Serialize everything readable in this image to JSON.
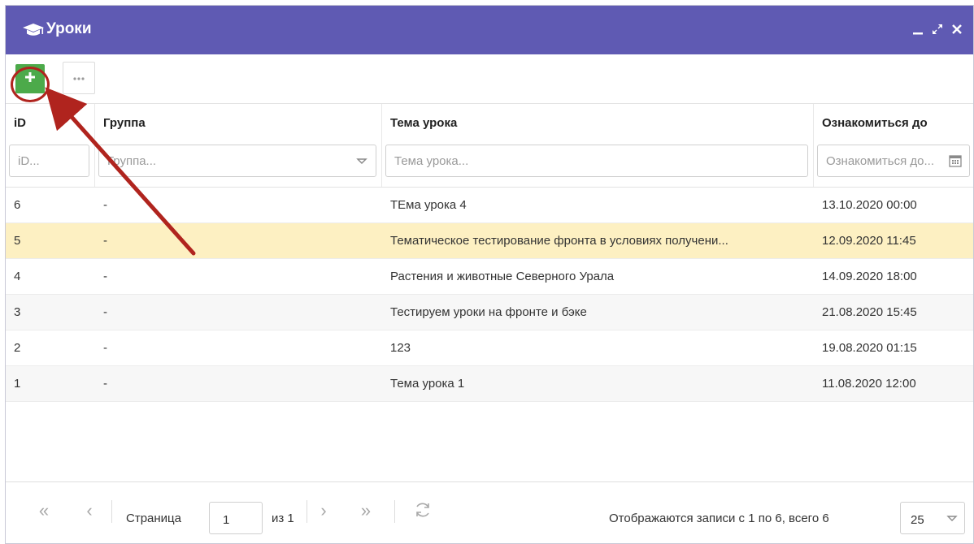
{
  "window": {
    "title": "Уроки",
    "icon": "graduation-cap-icon",
    "controls": [
      "minimize-icon",
      "maximize-icon",
      "close-icon"
    ],
    "title_bar_color": "#5f5ab3"
  },
  "toolbar": {
    "add_icon": "plus-icon",
    "add_button_color": "#4caa4a",
    "more_icon": "ellipsis-icon"
  },
  "columns": [
    {
      "label": "iD",
      "filter_placeholder": "iD...",
      "filter_icon": ""
    },
    {
      "label": "Группа",
      "filter_placeholder": "Группа...",
      "filter_icon": "dropdown-icon"
    },
    {
      "label": "Тема урока",
      "filter_placeholder": "Тема урока...",
      "filter_icon": ""
    },
    {
      "label": "Ознакомиться до",
      "filter_placeholder": "Ознакомиться до...",
      "filter_icon": "calendar-icon"
    }
  ],
  "rows": [
    {
      "id": "6",
      "group": "-",
      "topic": "ТЕма урока 4",
      "due": "13.10.2020 00:00"
    },
    {
      "id": "5",
      "group": "-",
      "topic": "Тематическое тестирование фронта в условиях получени...",
      "due": "12.09.2020 11:45"
    },
    {
      "id": "4",
      "group": "-",
      "topic": "Растения и животные Северного Урала",
      "due": "14.09.2020 18:00"
    },
    {
      "id": "3",
      "group": "-",
      "topic": "Тестируем уроки на фронте и бэке",
      "due": "21.08.2020 15:45"
    },
    {
      "id": "2",
      "group": "-",
      "topic": "123",
      "due": "19.08.2020 01:15"
    },
    {
      "id": "1",
      "group": "-",
      "topic": "Тема урока 1",
      "due": "11.08.2020 12:00"
    }
  ],
  "selected_row_color": "#fdf0c2",
  "pager": {
    "page_label": "Страница",
    "page_value": "1",
    "of_label": "из 1",
    "status": "Отображаются записи с 1 по 6, всего 6",
    "page_size": "25"
  },
  "annotation": {
    "arrow_color": "#b0241e"
  }
}
